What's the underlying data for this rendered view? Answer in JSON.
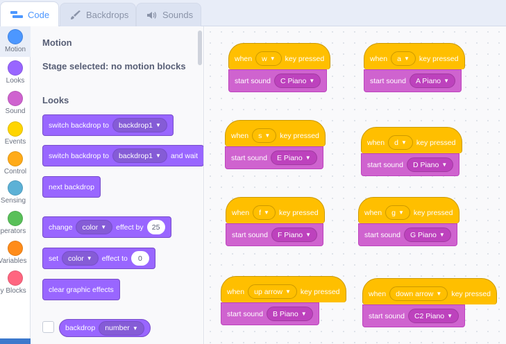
{
  "tabs": {
    "code": "Code",
    "backdrops": "Backdrops",
    "sounds": "Sounds"
  },
  "categories": [
    {
      "label": "Motion",
      "color": "#4c97ff"
    },
    {
      "label": "Looks",
      "color": "#9966ff"
    },
    {
      "label": "Sound",
      "color": "#cf63cf"
    },
    {
      "label": "Events",
      "color": "#ffd500"
    },
    {
      "label": "Control",
      "color": "#ffab19"
    },
    {
      "label": "Sensing",
      "color": "#5cb1d6"
    },
    {
      "label": "Operators",
      "color": "#59c059"
    },
    {
      "label": "Variables",
      "color": "#ff8c1a"
    },
    {
      "label": "My Blocks",
      "color": "#ff6680"
    }
  ],
  "palette": {
    "motion_heading": "Motion",
    "motion_note": "Stage selected: no motion blocks",
    "looks_heading": "Looks",
    "switch_backdrop": {
      "text": "switch backdrop to",
      "value": "backdrop1"
    },
    "switch_backdrop_wait": {
      "text": "switch backdrop to",
      "value": "backdrop1",
      "suffix": "and wait"
    },
    "next_backdrop": "next backdrop",
    "change_effect": {
      "text": "change",
      "effect": "color",
      "by": "effect by",
      "value": "25"
    },
    "set_effect": {
      "text": "set",
      "effect": "color",
      "to": "effect to",
      "value": "0"
    },
    "clear_effects": "clear graphic effects",
    "backdrop_reporter": {
      "text": "backdrop",
      "value": "number"
    }
  },
  "scripts": [
    {
      "key": "w",
      "sound": "C Piano"
    },
    {
      "key": "a",
      "sound": "A Piano"
    },
    {
      "key": "s",
      "sound": "E Piano"
    },
    {
      "key": "d",
      "sound": "D Piano"
    },
    {
      "key": "f",
      "sound": "F Piano"
    },
    {
      "key": "g",
      "sound": "G Piano"
    },
    {
      "key": "up arrow",
      "sound": "B Piano"
    },
    {
      "key": "down arrow",
      "sound": "C2 Piano"
    }
  ],
  "labels": {
    "when": "when",
    "key_pressed": "key pressed",
    "start_sound": "start sound"
  },
  "colors": {
    "accent": "#4c97ff",
    "looks": "#9966ff",
    "events": "#ffbf00",
    "sound": "#cf63cf"
  }
}
